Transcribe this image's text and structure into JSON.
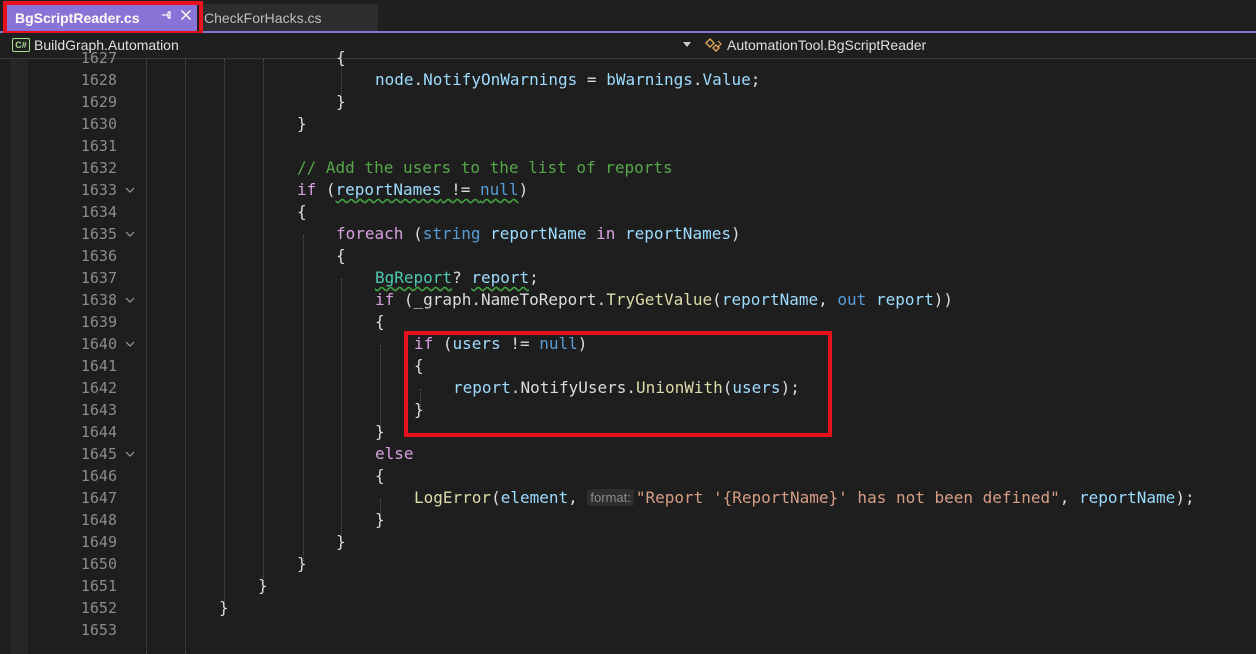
{
  "tabs": [
    {
      "label": "BgScriptReader.cs",
      "active": true
    },
    {
      "label": "CheckForHacks.cs",
      "active": false
    }
  ],
  "navbar": {
    "project_badge": "C#",
    "project": "BuildGraph.Automation",
    "member": "AutomationTool.BgScriptReader"
  },
  "icons": {
    "pin": "pin-icon",
    "close": "close-icon",
    "fold": "chevron-down-icon",
    "dropdown": "chevron-down-icon",
    "class": "class-icon"
  },
  "colors": {
    "accent": "#8a73d6",
    "highlight": "#e8101f",
    "keyword": "#569cd6",
    "control": "#d8a0df",
    "comment": "#57a64a",
    "string": "#d69d85",
    "type": "#4ec9b0"
  },
  "lines": [
    {
      "n": "1627",
      "fold": false
    },
    {
      "n": "1628",
      "fold": false
    },
    {
      "n": "1629",
      "fold": false
    },
    {
      "n": "1630",
      "fold": false
    },
    {
      "n": "1631",
      "fold": false
    },
    {
      "n": "1632",
      "fold": false
    },
    {
      "n": "1633",
      "fold": true
    },
    {
      "n": "1634",
      "fold": false
    },
    {
      "n": "1635",
      "fold": true
    },
    {
      "n": "1636",
      "fold": false
    },
    {
      "n": "1637",
      "fold": false
    },
    {
      "n": "1638",
      "fold": true
    },
    {
      "n": "1639",
      "fold": false
    },
    {
      "n": "1640",
      "fold": true
    },
    {
      "n": "1641",
      "fold": false
    },
    {
      "n": "1642",
      "fold": false
    },
    {
      "n": "1643",
      "fold": false
    },
    {
      "n": "1644",
      "fold": false
    },
    {
      "n": "1645",
      "fold": true
    },
    {
      "n": "1646",
      "fold": false
    },
    {
      "n": "1647",
      "fold": false
    },
    {
      "n": "1648",
      "fold": false
    },
    {
      "n": "1649",
      "fold": false
    },
    {
      "n": "1650",
      "fold": false
    },
    {
      "n": "1651",
      "fold": false
    },
    {
      "n": "1652",
      "fold": false
    },
    {
      "n": "1653",
      "fold": false
    }
  ],
  "code": {
    "l1627": {
      "brace": "{"
    },
    "l1628": {
      "node": "node",
      "dot1": ".",
      "prop": "NotifyOnWarnings",
      "eq": " = ",
      "var": "bWarnings",
      "dot2": ".",
      "value": "Value",
      "end": ";"
    },
    "l1629": {
      "brace": "}"
    },
    "l1630": {
      "brace": "}"
    },
    "l1632": {
      "comment": "// Add the users to the list of reports"
    },
    "l1633": {
      "kw": "if",
      "open": " (",
      "var": "reportNames",
      "op": " != ",
      "null": "null",
      "close": ")"
    },
    "l1634": {
      "brace": "{"
    },
    "l1635": {
      "kw": "foreach",
      "open": " (",
      "type": "string",
      "var": " reportName",
      "in": " in",
      "coll": " reportNames",
      "close": ")"
    },
    "l1636": {
      "brace": "{"
    },
    "l1637": {
      "type": "BgReport",
      "q": "? ",
      "var": "report",
      "end": ";"
    },
    "l1638": {
      "kw": "if",
      "open": " (",
      "obj": "_graph",
      "dot1": ".",
      "member": "NameToReport",
      "dot2": ".",
      "fn": "TryGetValue",
      "p1": "(",
      "arg1": "reportName",
      "comma": ", ",
      "out": "out",
      "arg2": " report",
      "p2": "))"
    },
    "l1639": {
      "brace": "{"
    },
    "l1640": {
      "kw": "if",
      "open": " (",
      "var": "users",
      "op": " != ",
      "null": "null",
      "close": ")"
    },
    "l1641": {
      "brace": "{"
    },
    "l1642": {
      "obj": "report",
      "dot1": ".",
      "member": "NotifyUsers",
      "dot2": ".",
      "fn": "UnionWith",
      "p1": "(",
      "arg": "users",
      "p2": ");"
    },
    "l1643": {
      "brace": "}"
    },
    "l1644": {
      "brace": "}"
    },
    "l1645": {
      "kw": "else"
    },
    "l1646": {
      "brace": "{"
    },
    "l1647": {
      "fn": "LogError",
      "p1": "(",
      "arg1": "element",
      "comma1": ", ",
      "hint": "format:",
      "str": "\"Report '{ReportName}' has not been defined\"",
      "comma2": ", ",
      "arg2": "reportName",
      "p2": ");"
    },
    "l1648": {
      "brace": "}"
    },
    "l1649": {
      "brace": "}"
    },
    "l1650": {
      "brace": "}"
    },
    "l1651": {
      "brace": "}"
    },
    "l1652": {
      "brace": "}"
    }
  }
}
